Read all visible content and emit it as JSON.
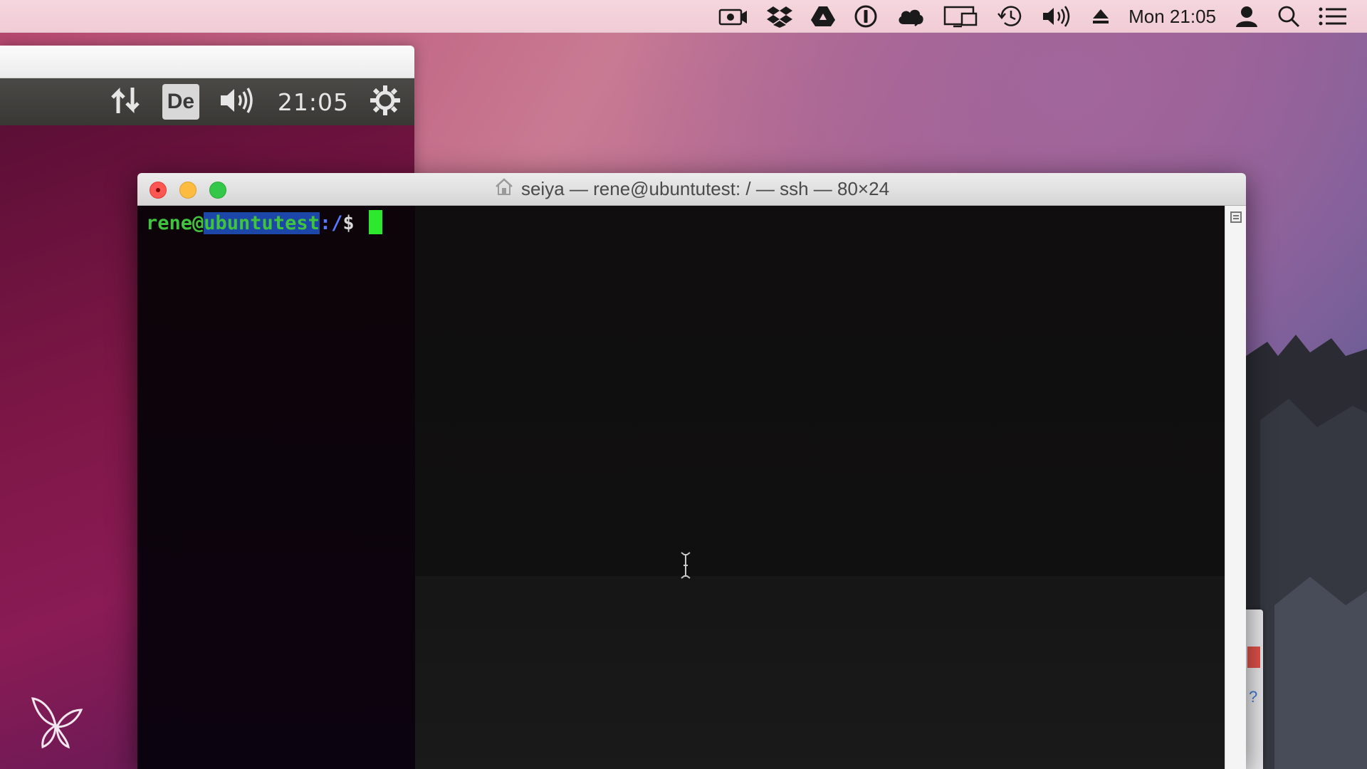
{
  "menubar": {
    "clock": "Mon 21:05",
    "icons": [
      "screen-record-icon",
      "dropbox-icon",
      "google-drive-icon",
      "onepassword-icon",
      "cloud-icon",
      "display-mirroring-icon",
      "time-machine-icon",
      "volume-icon",
      "eject-icon",
      "user-icon",
      "spotlight-search-icon",
      "notification-center-icon"
    ]
  },
  "vm": {
    "keyboard_layout": "De",
    "time": "21:05"
  },
  "terminal": {
    "title": "seiya — rene@ubuntutest: / — ssh — 80×24",
    "prompt_user": "rene@",
    "prompt_host": "ubuntutest",
    "prompt_path": ":/",
    "prompt_symbol": "$"
  },
  "colors": {
    "prompt_green": "#41c43d",
    "selection_blue": "#1c46a8",
    "cursor_green": "#2ee82e",
    "ubuntu_purple": "#7e1747"
  }
}
